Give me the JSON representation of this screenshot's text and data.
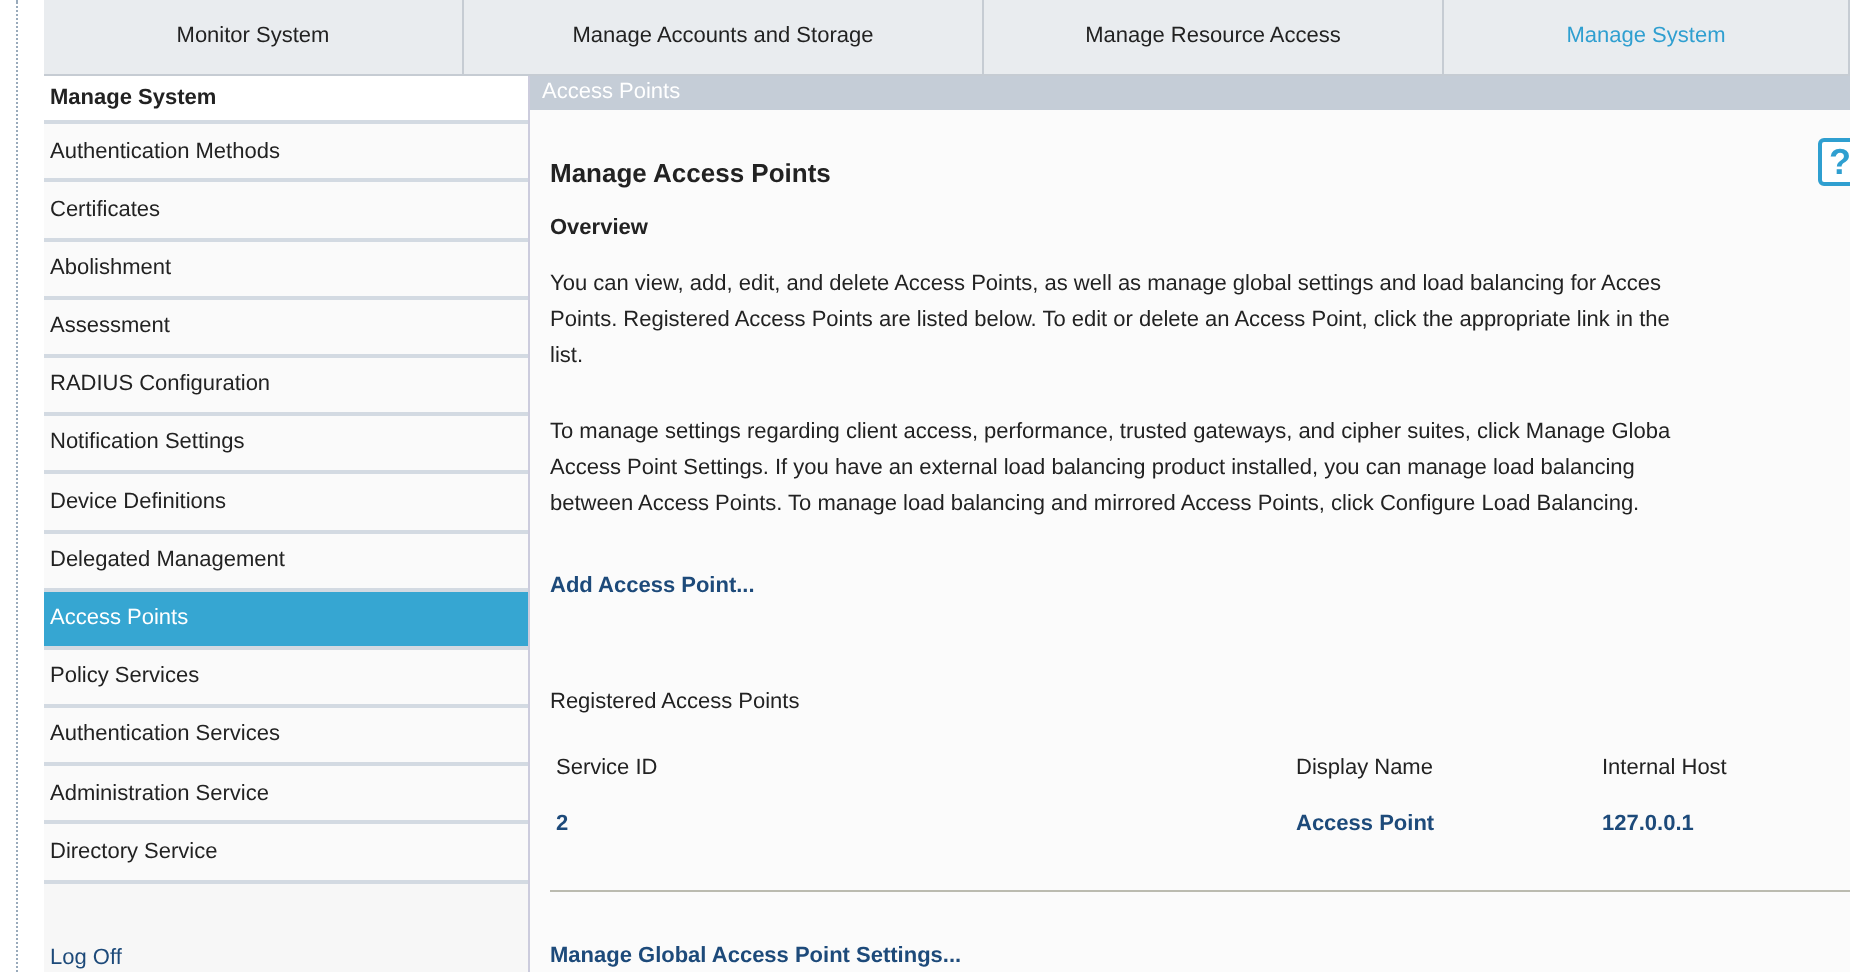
{
  "tabs": [
    {
      "label": "Monitor System",
      "selected": false
    },
    {
      "label": "Manage Accounts and Storage",
      "selected": false
    },
    {
      "label": "Manage Resource Access",
      "selected": false
    },
    {
      "label": "Manage System",
      "selected": true
    }
  ],
  "sidebar": {
    "title": "Manage System",
    "items": [
      {
        "label": "Authentication Methods",
        "selected": false
      },
      {
        "label": "Certificates",
        "selected": false
      },
      {
        "label": "Abolishment",
        "selected": false
      },
      {
        "label": "Assessment",
        "selected": false
      },
      {
        "label": "RADIUS Configuration",
        "selected": false
      },
      {
        "label": "Notification Settings",
        "selected": false
      },
      {
        "label": "Device Definitions",
        "selected": false
      },
      {
        "label": "Delegated Management",
        "selected": false
      },
      {
        "label": "Access Points",
        "selected": true
      },
      {
        "label": "Policy Services",
        "selected": false
      },
      {
        "label": "Authentication Services",
        "selected": false
      },
      {
        "label": "Administration Service",
        "selected": false
      },
      {
        "label": "Directory Service",
        "selected": false
      }
    ],
    "log_off": "Log Off"
  },
  "content": {
    "breadcrumb": "Access Points",
    "title": "Manage Access Points",
    "help": "?",
    "overview_heading": "Overview",
    "paragraphs": [
      [
        "You can view, add, edit, and delete Access Points, as well as manage global settings and load balancing for Acces",
        "Points. Registered Access Points are listed below. To edit or delete an Access Point, click the appropriate link in the",
        "list."
      ],
      [
        "To manage settings regarding client access, performance, trusted gateways, and cipher suites, click Manage Globa",
        "Access Point Settings. If you have an external load balancing product installed, you can manage load balancing",
        "between Access Points. To manage load balancing and mirrored Access Points, click Configure Load Balancing."
      ]
    ],
    "add_link": "Add Access Point...",
    "table_heading": "Registered Access Points",
    "table": {
      "columns": [
        "Service ID",
        "Display Name",
        "Internal Host"
      ],
      "rows": [
        [
          "2",
          "Access Point",
          "127.0.0.1"
        ]
      ]
    },
    "global_link": "Manage Global Access Point Settings..."
  }
}
